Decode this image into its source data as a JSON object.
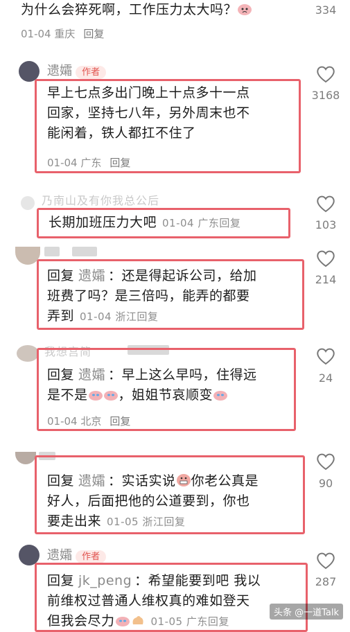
{
  "top": {
    "text": "为什么会猝死啊，工作压力太大吗？",
    "meta": "01-04 重庆",
    "reply": "回复",
    "likes": "334"
  },
  "c1": {
    "user": "遗孀",
    "tag": "作者",
    "line1": "早上七点多出门晚上十点多十一点",
    "line2": "回家，坚持七八年，另外周末也不",
    "line3": "能闲着，铁人都扛不住了",
    "meta": "01-04 广东",
    "reply": "回复",
    "likes": "3168"
  },
  "c2": {
    "user_faded": "乃南山及有你我总公后",
    "text": "长期加班压力大吧",
    "meta": "01-04 广东",
    "reply": "回复",
    "likes": "103"
  },
  "c3": {
    "pre": "回复",
    "to": "遗孀",
    "line1": "：还是得起诉公司，给加",
    "line2": "班费了吗？是三倍吗，能弄的都要",
    "line3": "弄到",
    "meta": "01-04 浙江",
    "reply": "回复",
    "likes": "214"
  },
  "c4": {
    "user_faded": "我想宫简",
    "pre": "回复",
    "to": "遗孀",
    "line1": "：早上这么早吗，住得远",
    "line2a": "是不是",
    "line2b": "，姐姐节哀顺变",
    "meta": "01-04 北京",
    "reply": "回复",
    "likes": "24"
  },
  "c5": {
    "pre": "回复",
    "to": "遗孀",
    "line1a": "：实话实说",
    "line1b": "你老公真是",
    "line2": "好人，后面把他的公道要到，你也",
    "line3": "要走出来",
    "meta": "01-05 浙江",
    "reply": "回复",
    "likes": "90"
  },
  "c6": {
    "user": "遗孀",
    "tag": "作者",
    "pre": "回复",
    "to": "jk_peng",
    "line1": "：希望能要到吧 我以",
    "line2": "前维权过普通人维权真的难如登天",
    "line3a": "但我会尽力",
    "meta": "01-05 广东",
    "reply": "回复",
    "likes": "287"
  },
  "watermark": "头条 @一道Talk",
  "colors": {
    "accent": "#e8616b",
    "author_tag": "#e1544f"
  }
}
